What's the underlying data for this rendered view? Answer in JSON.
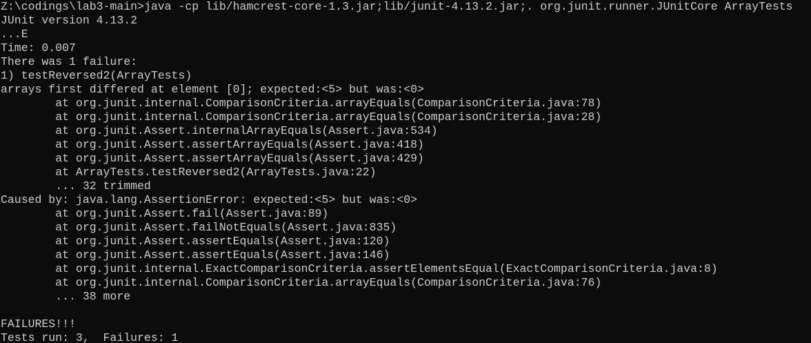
{
  "console": {
    "lines": [
      "Z:\\codings\\lab3-main>java -cp lib/hamcrest-core-1.3.jar;lib/junit-4.13.2.jar;. org.junit.runner.JUnitCore ArrayTests",
      "JUnit version 4.13.2",
      "...E",
      "Time: 0.007",
      "There was 1 failure:",
      "1) testReversed2(ArrayTests)",
      "arrays first differed at element [0]; expected:<5> but was:<0>",
      "        at org.junit.internal.ComparisonCriteria.arrayEquals(ComparisonCriteria.java:78)",
      "        at org.junit.internal.ComparisonCriteria.arrayEquals(ComparisonCriteria.java:28)",
      "        at org.junit.Assert.internalArrayEquals(Assert.java:534)",
      "        at org.junit.Assert.assertArrayEquals(Assert.java:418)",
      "        at org.junit.Assert.assertArrayEquals(Assert.java:429)",
      "        at ArrayTests.testReversed2(ArrayTests.java:22)",
      "        ... 32 trimmed",
      "Caused by: java.lang.AssertionError: expected:<5> but was:<0>",
      "        at org.junit.Assert.fail(Assert.java:89)",
      "        at org.junit.Assert.failNotEquals(Assert.java:835)",
      "        at org.junit.Assert.assertEquals(Assert.java:120)",
      "        at org.junit.Assert.assertEquals(Assert.java:146)",
      "        at org.junit.internal.ExactComparisonCriteria.assertElementsEqual(ExactComparisonCriteria.java:8)",
      "        at org.junit.internal.ComparisonCriteria.arrayEquals(ComparisonCriteria.java:76)",
      "        ... 38 more",
      "",
      "FAILURES!!!",
      "Tests run: 3,  Failures: 1"
    ]
  },
  "colors": {
    "background": "#0c0c0c",
    "foreground": "#cccccc"
  }
}
